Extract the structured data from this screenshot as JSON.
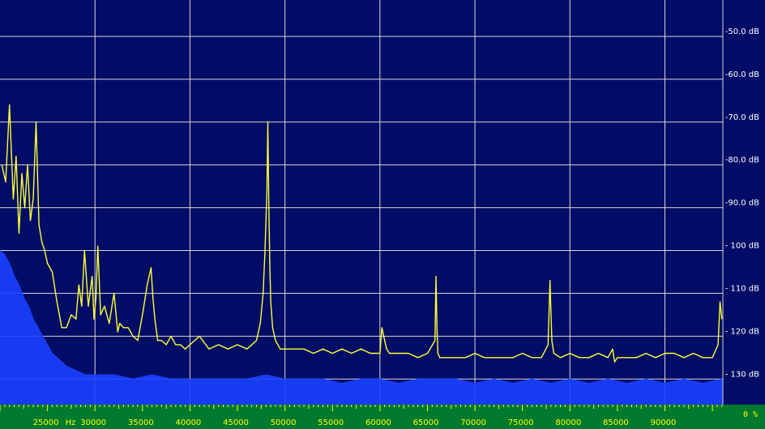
{
  "chart_data": {
    "type": "line",
    "title": "",
    "xlabel": "",
    "ylabel": "",
    "x_unit_label": "Hz",
    "xlim": [
      20000,
      96100
    ],
    "ylim": [
      -136,
      -41.5
    ],
    "x_ticks": [
      {
        "value": 25000,
        "label": "25000"
      },
      {
        "value": 30000,
        "label": "30000"
      },
      {
        "value": 35000,
        "label": "35000"
      },
      {
        "value": 40000,
        "label": "40000"
      },
      {
        "value": 45000,
        "label": "45000"
      },
      {
        "value": 50000,
        "label": "50000"
      },
      {
        "value": 55000,
        "label": "55000"
      },
      {
        "value": 60000,
        "label": "60000"
      },
      {
        "value": 65000,
        "label": "65000"
      },
      {
        "value": 70000,
        "label": "70000"
      },
      {
        "value": 75000,
        "label": "75000"
      },
      {
        "value": 80000,
        "label": "80000"
      },
      {
        "value": 85000,
        "label": "85000"
      },
      {
        "value": 90000,
        "label": "90000"
      }
    ],
    "y_ticks": [
      {
        "value": -50,
        "label": "-50.0 dB"
      },
      {
        "value": -60,
        "label": "-60.0 dB"
      },
      {
        "value": -70,
        "label": "-70.0 dB"
      },
      {
        "value": -80,
        "label": "-80.0 dB"
      },
      {
        "value": -90,
        "label": "-90.0 dB"
      },
      {
        "value": -100,
        "label": "- 100 dB"
      },
      {
        "value": -110,
        "label": "- 110 dB"
      },
      {
        "value": -120,
        "label": "- 120 dB"
      },
      {
        "value": -130,
        "label": "- 130 dB"
      }
    ],
    "corner_readout": "0 %",
    "grid": true,
    "colors": {
      "background": "#000c66",
      "grid": "#d8d8d8",
      "axis_text": "#ffffff",
      "bottom_bar": "#007a2e",
      "bottom_text": "#ffff00",
      "peak_trace": "#ffff33",
      "average_trace": "#1a40ff"
    },
    "series": [
      {
        "role": "peak",
        "x": [
          20200,
          20600,
          21000,
          21400,
          21700,
          22000,
          22300,
          22600,
          22900,
          23200,
          23500,
          23800,
          24100,
          24400,
          24700,
          25000,
          25500,
          26000,
          26500,
          27000,
          27500,
          28000,
          28300,
          28600,
          28900,
          29300,
          29700,
          29900,
          30100,
          30300,
          30600,
          31000,
          31500,
          32000,
          32400,
          32600,
          33000,
          33500,
          34000,
          34500,
          35000,
          35500,
          35900,
          36100,
          36300,
          36600,
          37000,
          37500,
          38000,
          38500,
          39000,
          39500,
          40000,
          40500,
          41000,
          42000,
          43000,
          44000,
          45000,
          46000,
          47000,
          47400,
          47700,
          47900,
          48100,
          48200,
          48300,
          48400,
          48500,
          48700,
          49000,
          49500,
          50000,
          51000,
          52000,
          53000,
          54000,
          55000,
          56000,
          57000,
          58000,
          59000,
          60000,
          60200,
          60400,
          60700,
          61000,
          62000,
          63000,
          64000,
          65000,
          65800,
          65900,
          66000,
          66100,
          66300,
          67000,
          68000,
          69000,
          70000,
          71000,
          72000,
          73000,
          74000,
          75000,
          76000,
          77000,
          77700,
          77900,
          78000,
          78100,
          78300,
          79000,
          80000,
          81000,
          82000,
          83000,
          84000,
          84500,
          84700,
          85000,
          86000,
          87000,
          88000,
          89000,
          90000,
          91000,
          92000,
          93000,
          94000,
          95000,
          95600,
          95800,
          96000
        ],
        "y": [
          -80,
          -84,
          -66,
          -88,
          -78,
          -96,
          -82,
          -90,
          -80,
          -93,
          -88,
          -70,
          -94,
          -98,
          -100,
          -103,
          -105,
          -112,
          -118,
          -118,
          -115,
          -116,
          -108,
          -113,
          -100,
          -113,
          -106,
          -116,
          -111,
          -99,
          -115,
          -113,
          -117,
          -110,
          -119,
          -117,
          -118,
          -118,
          -120,
          -121,
          -115,
          -108,
          -104,
          -111,
          -116,
          -121,
          -121,
          -122,
          -120,
          -122,
          -122,
          -123,
          -122,
          -121,
          -120,
          -123,
          -122,
          -123,
          -122,
          -123,
          -121,
          -117,
          -110,
          -100,
          -86,
          -70,
          -89,
          -103,
          -112,
          -118,
          -121,
          -123,
          -123,
          -123,
          -123,
          -124,
          -123,
          -124,
          -123,
          -124,
          -123,
          -124,
          -124,
          -118,
          -120,
          -123,
          -124,
          -124,
          -124,
          -125,
          -124,
          -121,
          -106,
          -118,
          -124,
          -125,
          -125,
          -125,
          -125,
          -124,
          -125,
          -125,
          -125,
          -125,
          -124,
          -125,
          -125,
          -122,
          -107,
          -114,
          -121,
          -124,
          -125,
          -124,
          -125,
          -125,
          -124,
          -125,
          -123,
          -126,
          -125,
          -125,
          -125,
          -124,
          -125,
          -124,
          -124,
          -125,
          -124,
          -125,
          -125,
          -122,
          -112,
          -116
        ]
      },
      {
        "role": "average",
        "x": [
          20000,
          20500,
          21000,
          21500,
          22000,
          22500,
          23000,
          23500,
          24000,
          24500,
          25000,
          25500,
          26000,
          27000,
          28000,
          29000,
          30000,
          32000,
          34000,
          36000,
          38000,
          40000,
          42000,
          44000,
          46000,
          48000,
          50000,
          52000,
          54000,
          56000,
          58000,
          60000,
          62000,
          64000,
          66000,
          68000,
          70000,
          72000,
          74000,
          76000,
          78000,
          80000,
          82000,
          84000,
          86000,
          88000,
          90000,
          92000,
          94000,
          96000
        ],
        "y": [
          -100,
          -101,
          -103,
          -106,
          -108,
          -111,
          -113,
          -116,
          -118,
          -120,
          -122,
          -124,
          -125,
          -127,
          -128,
          -129,
          -129,
          -129,
          -130,
          -129,
          -130,
          -130,
          -130,
          -130,
          -130,
          -129,
          -130,
          -130,
          -130,
          -131,
          -130,
          -130,
          -131,
          -130,
          -130,
          -130,
          -131,
          -130,
          -131,
          -130,
          -131,
          -130,
          -131,
          -130,
          -131,
          -130,
          -131,
          -130,
          -131,
          -130
        ]
      }
    ]
  }
}
